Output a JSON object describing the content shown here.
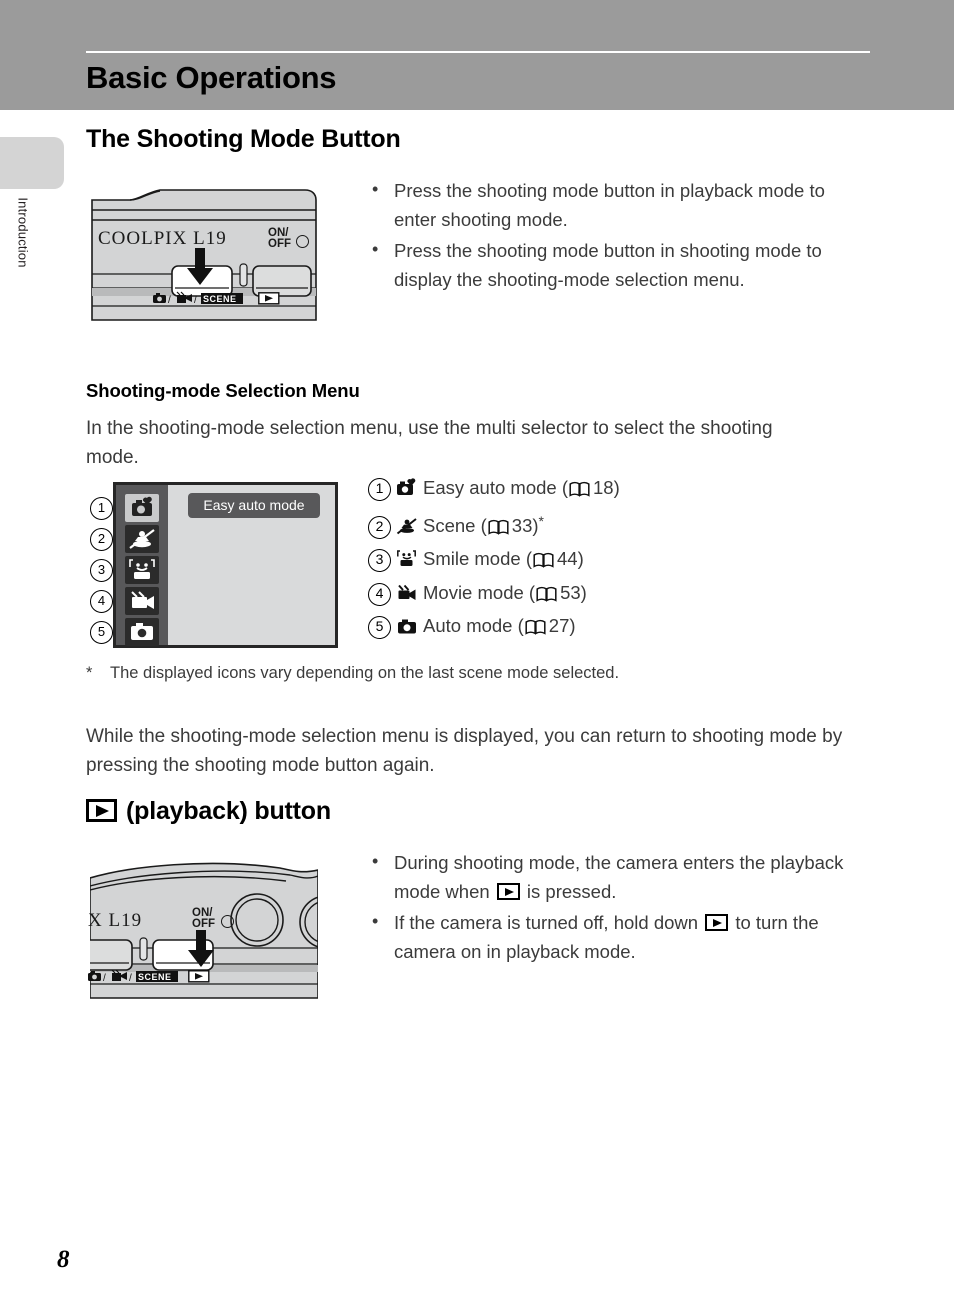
{
  "page": {
    "chapter_title": "Basic Operations",
    "side_tab_label": "Introduction",
    "page_number": "8"
  },
  "shooting_mode_section": {
    "heading": "The Shooting Mode Button",
    "camera_figure": {
      "model_label": "COOLPIX L19",
      "power_label_line1": "ON/",
      "power_label_line2": "OFF",
      "scene_label": "SCENE",
      "camera_icon": "camera-icon",
      "movie_icon": "movie-icon",
      "playback_icon": "playback-icon",
      "arrow_icon": "down-arrow-icon"
    },
    "bullets": [
      "Press the shooting mode button in playback mode to enter shooting mode.",
      "Press the shooting mode button in shooting mode to display the shooting-mode selection menu."
    ]
  },
  "selection_menu_section": {
    "heading": "Shooting-mode Selection Menu",
    "intro": "In the shooting-mode selection menu, use the multi selector to select the shooting mode.",
    "screen": {
      "selected_label": "Easy auto mode",
      "markers": [
        "1",
        "2",
        "3",
        "4",
        "5"
      ],
      "icons": [
        "easy-auto-mode-icon",
        "scene-mode-icon",
        "smile-mode-icon",
        "movie-mode-icon",
        "auto-mode-icon"
      ]
    },
    "items": [
      {
        "num": "1",
        "icon": "easy-auto-mode-icon",
        "label": "Easy auto mode",
        "ref_page": "18",
        "asterisk": false
      },
      {
        "num": "2",
        "icon": "scene-mode-icon",
        "label": "Scene",
        "ref_page": "33",
        "asterisk": true
      },
      {
        "num": "3",
        "icon": "smile-mode-icon",
        "label": "Smile mode",
        "ref_page": "44",
        "asterisk": false
      },
      {
        "num": "4",
        "icon": "movie-mode-icon",
        "label": "Movie mode",
        "ref_page": "53",
        "asterisk": false
      },
      {
        "num": "5",
        "icon": "auto-mode-icon",
        "label": "Auto mode",
        "ref_page": "27",
        "asterisk": false
      }
    ],
    "footnote_marker": "*",
    "footnote": "The displayed icons vary depending on the last scene mode selected.",
    "closing_paragraph": "While the shooting-mode selection menu is displayed, you can return to shooting mode by pressing the shooting mode button again."
  },
  "playback_section": {
    "heading_suffix": "(playback) button",
    "heading_icon": "playback-icon",
    "camera_figure": {
      "model_label": "X L19",
      "power_label_line1": "ON/",
      "power_label_line2": "OFF",
      "scene_label": "SCENE",
      "arrow_icon": "down-arrow-icon"
    },
    "bullets": [
      {
        "before": "During shooting mode, the camera enters the playback mode when ",
        "icon": "playback-icon",
        "after": " is pressed."
      },
      {
        "before": "If the camera is turned off, hold down ",
        "icon": "playback-icon",
        "after": " to turn the camera on in playback mode."
      }
    ]
  },
  "colors": {
    "header_band": "#9b9b9b",
    "side_tab": "#d4d4d4",
    "menu_icon_column": "#58585a",
    "menu_content": "#d9dadb",
    "body_text": "#3b3b3b"
  }
}
